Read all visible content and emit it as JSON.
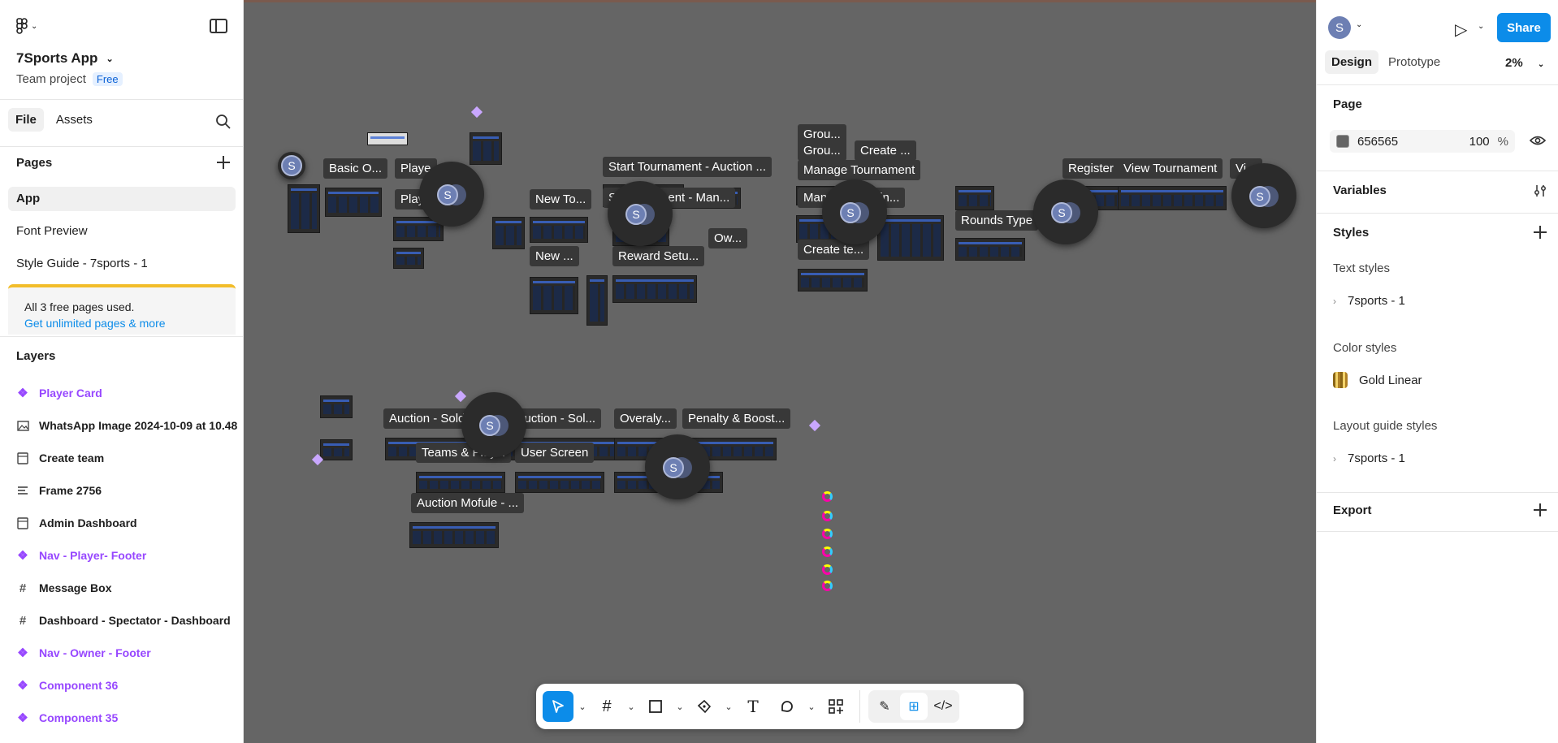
{
  "left": {
    "project_name": "7Sports App",
    "project_type": "Team project",
    "plan_badge": "Free",
    "tabs": [
      {
        "label": "File"
      },
      {
        "label": "Assets"
      }
    ],
    "pages_heading": "Pages",
    "pages": [
      {
        "label": "App"
      },
      {
        "label": "Font Preview"
      },
      {
        "label": "Style Guide - 7sports - 1"
      }
    ],
    "upsell_text": "All 3 free pages used.",
    "upsell_link": "Get unlimited pages & more",
    "layers_heading": "Layers",
    "layers": [
      {
        "label": "Player Card",
        "icon": "component-icon"
      },
      {
        "label": "WhatsApp Image 2024-10-09 at 10.48",
        "icon": "image-icon"
      },
      {
        "label": "Create team",
        "icon": "frame-icon"
      },
      {
        "label": "Frame 2756",
        "icon": "auto-layout-icon"
      },
      {
        "label": "Admin Dashboard",
        "icon": "frame-icon"
      },
      {
        "label": "Nav - Player- Footer",
        "icon": "component-icon"
      },
      {
        "label": "Message Box",
        "icon": "hash-frame-icon"
      },
      {
        "label": "Dashboard - Spectator - Dashboard",
        "icon": "hash-frame-icon"
      },
      {
        "label": "Nav - Owner - Footer",
        "icon": "component-icon"
      },
      {
        "label": "Component 36",
        "icon": "component-icon"
      },
      {
        "label": "Component 35",
        "icon": "component-icon"
      }
    ]
  },
  "canvas": {
    "frame_labels": [
      "Basic O...",
      "Playe",
      "Play",
      "New To...",
      "Start Tournament -  Auction ...",
      "S...ournament - Man...",
      "Ow...",
      "New ...",
      "Reward Setu...",
      "Grou...",
      "Grou...",
      "Create ...",
      "Manage Tournament",
      "Man...h - Scorin...",
      "Create te...",
      "Rounds Type",
      "Register ...",
      "View Tournament",
      "Vi...",
      "Auction - Sold",
      "...uction - Sol...",
      "Overaly...",
      "Penalty & Boost...",
      "Teams & Play...",
      "User Screen",
      "Auction Mofule - ..."
    ],
    "cursor_initial": "S",
    "help": "?"
  },
  "right": {
    "avatar_initial": "S",
    "share_label": "Share",
    "tabs": [
      {
        "label": "Design"
      },
      {
        "label": "Prototype"
      }
    ],
    "zoom": "2%",
    "page_heading": "Page",
    "page_fill_hex": "656565",
    "page_fill_opacity": "100",
    "percent": "%",
    "variables_heading": "Variables",
    "styles_heading": "Styles",
    "text_styles_heading": "Text styles",
    "text_style": "7sports - 1",
    "color_styles_heading": "Color styles",
    "color_style": "Gold Linear",
    "layout_guide_heading": "Layout guide styles",
    "layout_guide_style": "7sports - 1",
    "export_heading": "Export"
  },
  "colors": {
    "accent": "#0c8ce9",
    "canvas": "#656565",
    "component": "#9747ff"
  }
}
